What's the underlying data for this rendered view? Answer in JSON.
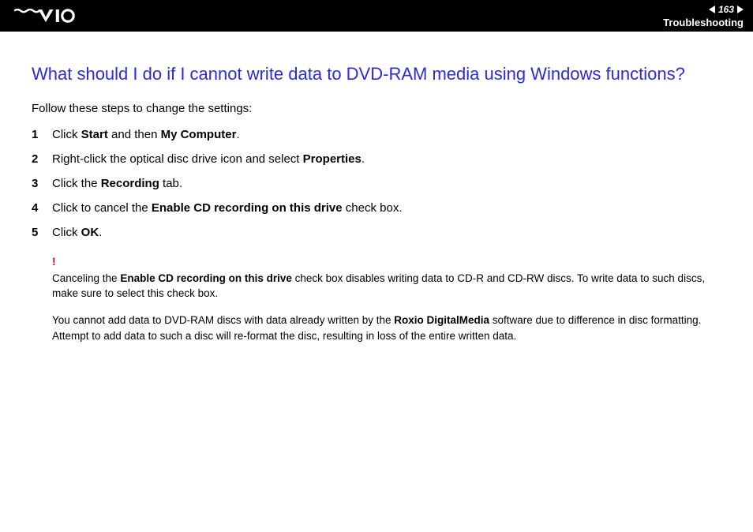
{
  "header": {
    "page_number": "163",
    "section": "Troubleshooting"
  },
  "title": "What should I do if I cannot write data to DVD-RAM media using Windows functions?",
  "intro": "Follow these steps to change the settings:",
  "steps": [
    {
      "num": "1",
      "parts": [
        "Click ",
        "Start",
        " and then ",
        "My Computer",
        "."
      ]
    },
    {
      "num": "2",
      "parts": [
        "Right-click the optical disc drive icon and select ",
        "Properties",
        "."
      ]
    },
    {
      "num": "3",
      "parts": [
        "Click the ",
        "Recording",
        " tab."
      ]
    },
    {
      "num": "4",
      "parts": [
        "Click to cancel the ",
        "Enable CD recording on this drive",
        " check box."
      ]
    },
    {
      "num": "5",
      "parts": [
        "Click ",
        "OK",
        "."
      ]
    }
  ],
  "warning_mark": "!",
  "note1_parts": [
    "Canceling the ",
    "Enable CD recording on this drive",
    " check box disables writing data to CD-R and CD-RW discs. To write data to such discs, make sure to select this check box."
  ],
  "note2_parts": [
    "You cannot add data to DVD-RAM discs with data already written by the ",
    "Roxio DigitalMedia",
    " software due to difference in disc formatting. Attempt to add data to such a disc will re-format the disc, resulting in loss of the entire written data."
  ]
}
